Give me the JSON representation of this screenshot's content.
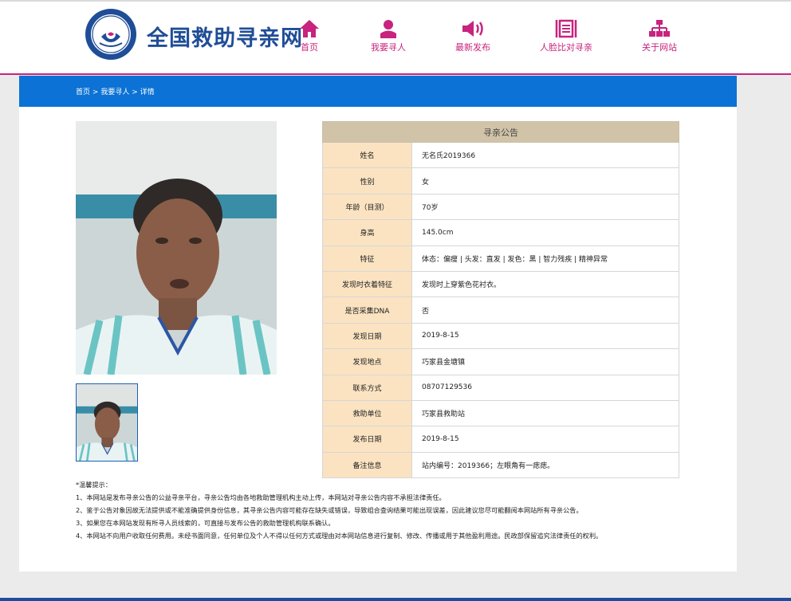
{
  "header": {
    "seal_text": "救助管理",
    "site_title": "全国救助寻亲网",
    "nav": [
      {
        "label": "首页",
        "icon": "home-icon"
      },
      {
        "label": "我要寻人",
        "icon": "person-icon"
      },
      {
        "label": "最新发布",
        "icon": "speaker-icon"
      },
      {
        "label": "人脸比对寻亲",
        "icon": "face-compare-icon"
      },
      {
        "label": "关于网站",
        "icon": "sitemap-icon"
      }
    ],
    "accent_color": "#c8237e",
    "title_color": "#1f4d97"
  },
  "breadcrumb": {
    "home": "首页",
    "sep1": ">",
    "search": "我要寻人",
    "sep2": ">",
    "current": "详情",
    "bar_color": "#0c72d5"
  },
  "table": {
    "title": "寻亲公告",
    "rows": [
      {
        "label": "姓名",
        "value": "无名氏2019366"
      },
      {
        "label": "性别",
        "value": "女"
      },
      {
        "label": "年龄（目测）",
        "value": "70岁"
      },
      {
        "label": "身高",
        "value": "145.0cm"
      },
      {
        "label": "特征",
        "value": "体态：偏瘦 | 头发：直发 | 发色：黑 | 智力残疾 | 精神异常"
      },
      {
        "label": "发现时衣着特征",
        "value": "发现时上穿紫色花衬衣。"
      },
      {
        "label": "是否采集DNA",
        "value": "否"
      },
      {
        "label": "发现日期",
        "value": "2019-8-15"
      },
      {
        "label": "发现地点",
        "value": "巧家县金塘镇"
      },
      {
        "label": "联系方式",
        "value": "08707129536"
      },
      {
        "label": "救助单位",
        "value": "巧家县救助站"
      },
      {
        "label": "发布日期",
        "value": "2019-8-15"
      },
      {
        "label": "备注信息",
        "value": "站内编号：2019366；左眼角有一痣痣。"
      }
    ]
  },
  "notice": {
    "heading": "*温馨提示：",
    "items": [
      "1、本网站是发布寻亲公告的公益寻亲平台，寻亲公告均由各地救助管理机构主动上传，本网站对寻亲公告内容不承担法律责任。",
      "2、鉴于公告对象因故无法提供或不能准确提供身份信息，其寻亲公告内容可能存在缺失或错误，导致组合查询结果可能出现误差，因此建议您尽可能翻阅本网站所有寻亲公告。",
      "3、如果您在本网站发现有所寻人员线索的，可直接与发布公告的救助管理机构联系确认。",
      "4、本网站不向用户收取任何费用。未经书面同意，任何单位及个人不得以任何方式或理由对本网站信息进行复制、修改、传播或用于其他盈利用途。民政部保留追究法律责任的权利。"
    ]
  }
}
